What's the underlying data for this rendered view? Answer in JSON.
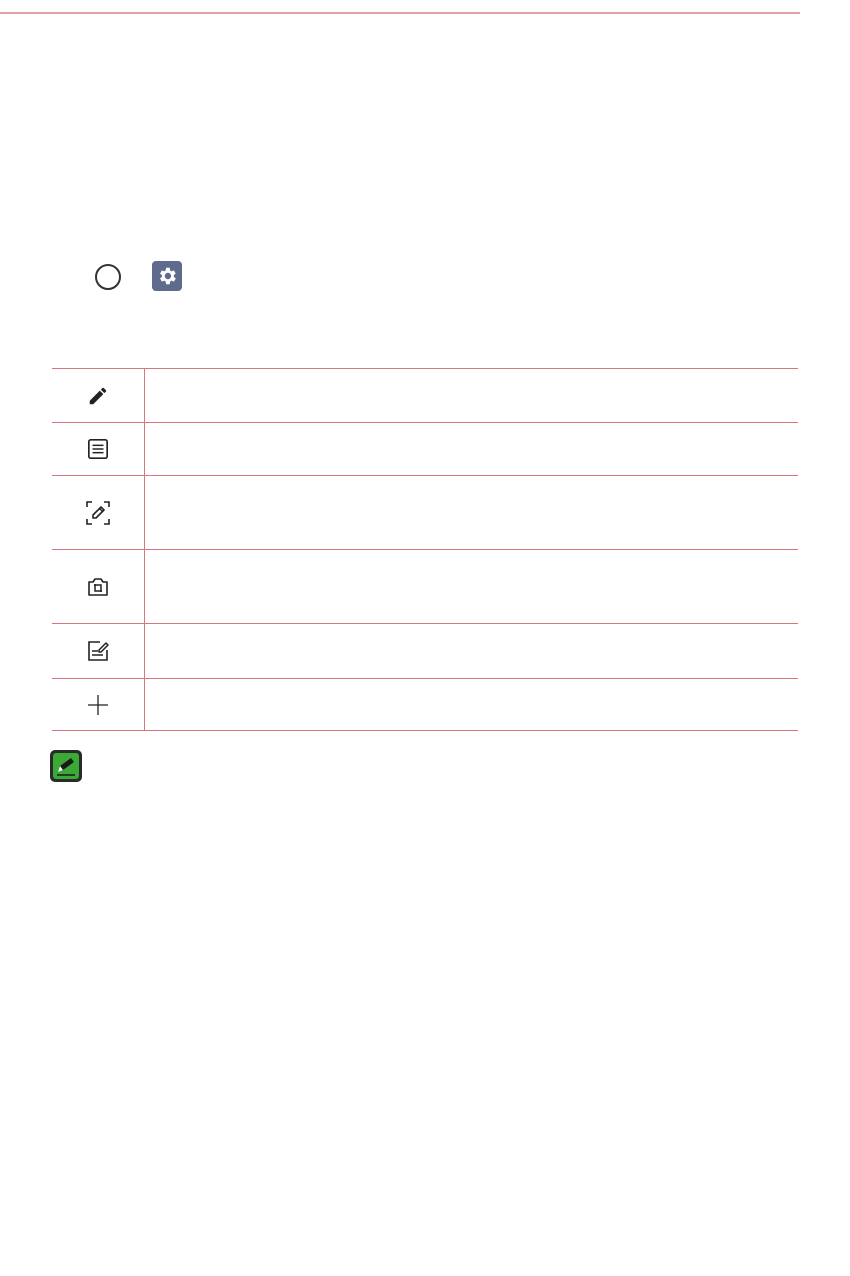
{
  "icons": {
    "home": "home-circle-icon",
    "settings": "gear-icon",
    "note": "note-pencil-icon"
  },
  "colors": {
    "rule": "#e0a0a4",
    "table_border": "#d9767d",
    "settings_bg": "#5e6b8c",
    "note_green": "#3aa935"
  },
  "table": {
    "rows": [
      {
        "icon": "pencil-icon",
        "description": ""
      },
      {
        "icon": "list-icon",
        "description": ""
      },
      {
        "icon": "capture-pencil-icon",
        "description": ""
      },
      {
        "icon": "crop-image-icon",
        "description": ""
      },
      {
        "icon": "edit-note-icon",
        "description": ""
      },
      {
        "icon": "plus-icon",
        "description": ""
      }
    ]
  }
}
